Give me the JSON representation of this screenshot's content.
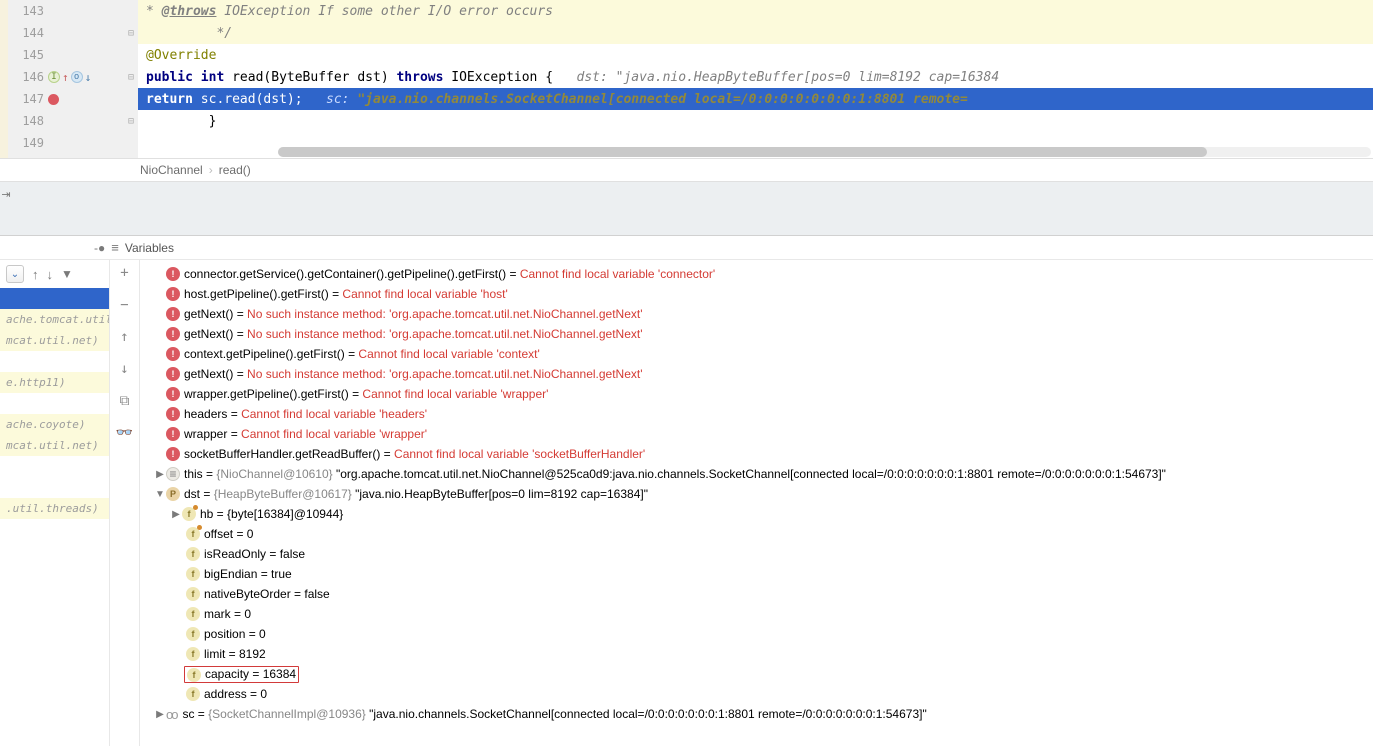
{
  "editor": {
    "lines": [
      {
        "n": 143,
        "yellow": true
      },
      {
        "n": 144,
        "yellow": true,
        "fold": "⊟"
      },
      {
        "n": 145
      },
      {
        "n": 146,
        "icons": true,
        "fold": "⊟"
      },
      {
        "n": 147,
        "bp": true
      },
      {
        "n": 148,
        "fold": "⊟"
      },
      {
        "n": 149
      }
    ],
    "doc_throws": "@throws",
    "doc_text": " IOException If some other I/O error occurs",
    "doc_end": "         */",
    "override": "@Override",
    "l146_public": "public ",
    "l146_int": "int ",
    "l146_read": "read(ByteBuffer dst) ",
    "l146_throws": "throws ",
    "l146_ioe": "IOException {",
    "l146_inlay": "   dst: \"java.nio.HeapByteBuffer[pos=0 lim=8192 cap=16384",
    "l147_return": "return ",
    "l147_body": "sc.read(dst);",
    "l147_inlay_k": "   sc: ",
    "l147_inlay_v": "\"java.nio.channels.SocketChannel[connected local=/0:0:0:0:0:0:0:1:8801 remote=",
    "l148": "        }"
  },
  "breadcrumb": {
    "a": "NioChannel",
    "b": "read()"
  },
  "varsHeader": "Variables",
  "watches": [
    {
      "name": "connector.getService().getContainer().getPipeline().getFirst()",
      "err": "Cannot find local variable 'connector'"
    },
    {
      "name": "host.getPipeline().getFirst()",
      "err": "Cannot find local variable 'host'"
    },
    {
      "name": "getNext()",
      "err": "No such instance method: 'org.apache.tomcat.util.net.NioChannel.getNext'"
    },
    {
      "name": "getNext()",
      "err": "No such instance method: 'org.apache.tomcat.util.net.NioChannel.getNext'"
    },
    {
      "name": "context.getPipeline().getFirst()",
      "err": "Cannot find local variable 'context'"
    },
    {
      "name": "getNext()",
      "err": "No such instance method: 'org.apache.tomcat.util.net.NioChannel.getNext'"
    },
    {
      "name": "wrapper.getPipeline().getFirst()",
      "err": "Cannot find local variable 'wrapper'"
    },
    {
      "name": "headers",
      "err": "Cannot find local variable 'headers'"
    },
    {
      "name": "wrapper",
      "err": "Cannot find local variable 'wrapper'"
    },
    {
      "name": "socketBufferHandler.getReadBuffer()",
      "err": "Cannot find local variable 'socketBufferHandler'"
    }
  ],
  "thisRow": {
    "name": "this",
    "type": "{NioChannel@10610}",
    "val": "\"org.apache.tomcat.util.net.NioChannel@525ca0d9:java.nio.channels.SocketChannel[connected local=/0:0:0:0:0:0:0:1:8801 remote=/0:0:0:0:0:0:0:1:54673]\""
  },
  "dstRow": {
    "name": "dst",
    "type": "{HeapByteBuffer@10617}",
    "val": "\"java.nio.HeapByteBuffer[pos=0 lim=8192 cap=16384]\""
  },
  "dstFields": [
    {
      "icon": "fhat",
      "arrow": "▶",
      "txt": "hb = {byte[16384]@10944}"
    },
    {
      "icon": "fhat",
      "txt": "offset = 0"
    },
    {
      "icon": "f",
      "txt": "isReadOnly = false"
    },
    {
      "icon": "f",
      "txt": "bigEndian = true"
    },
    {
      "icon": "f",
      "txt": "nativeByteOrder = false"
    },
    {
      "icon": "f",
      "txt": "mark = 0"
    },
    {
      "icon": "f",
      "txt": "position = 0"
    },
    {
      "icon": "f",
      "txt": "limit = 8192"
    },
    {
      "icon": "f",
      "txt": "capacity = 16384",
      "red": true
    },
    {
      "icon": "f",
      "txt": "address = 0"
    }
  ],
  "scRow": {
    "name": "sc",
    "type": "{SocketChannelImpl@10936}",
    "val": "\"java.nio.channels.SocketChannel[connected local=/0:0:0:0:0:0:0:1:8801 remote=/0:0:0:0:0:0:0:1:54673]\""
  },
  "frames": [
    {
      "sel": true,
      "txt": ""
    },
    {
      "y": true,
      "txt": "ache.tomcat.util."
    },
    {
      "y": true,
      "txt": "mcat.util.net)"
    },
    {
      "txt": ""
    },
    {
      "y": true,
      "txt": "e.http11)"
    },
    {
      "txt": ""
    },
    {
      "y": true,
      "txt": "ache.coyote)"
    },
    {
      "y": true,
      "txt": "mcat.util.net)"
    },
    {
      "txt": ""
    },
    {
      "txt": ""
    },
    {
      "y": true,
      "txt": ".util.threads)"
    }
  ]
}
